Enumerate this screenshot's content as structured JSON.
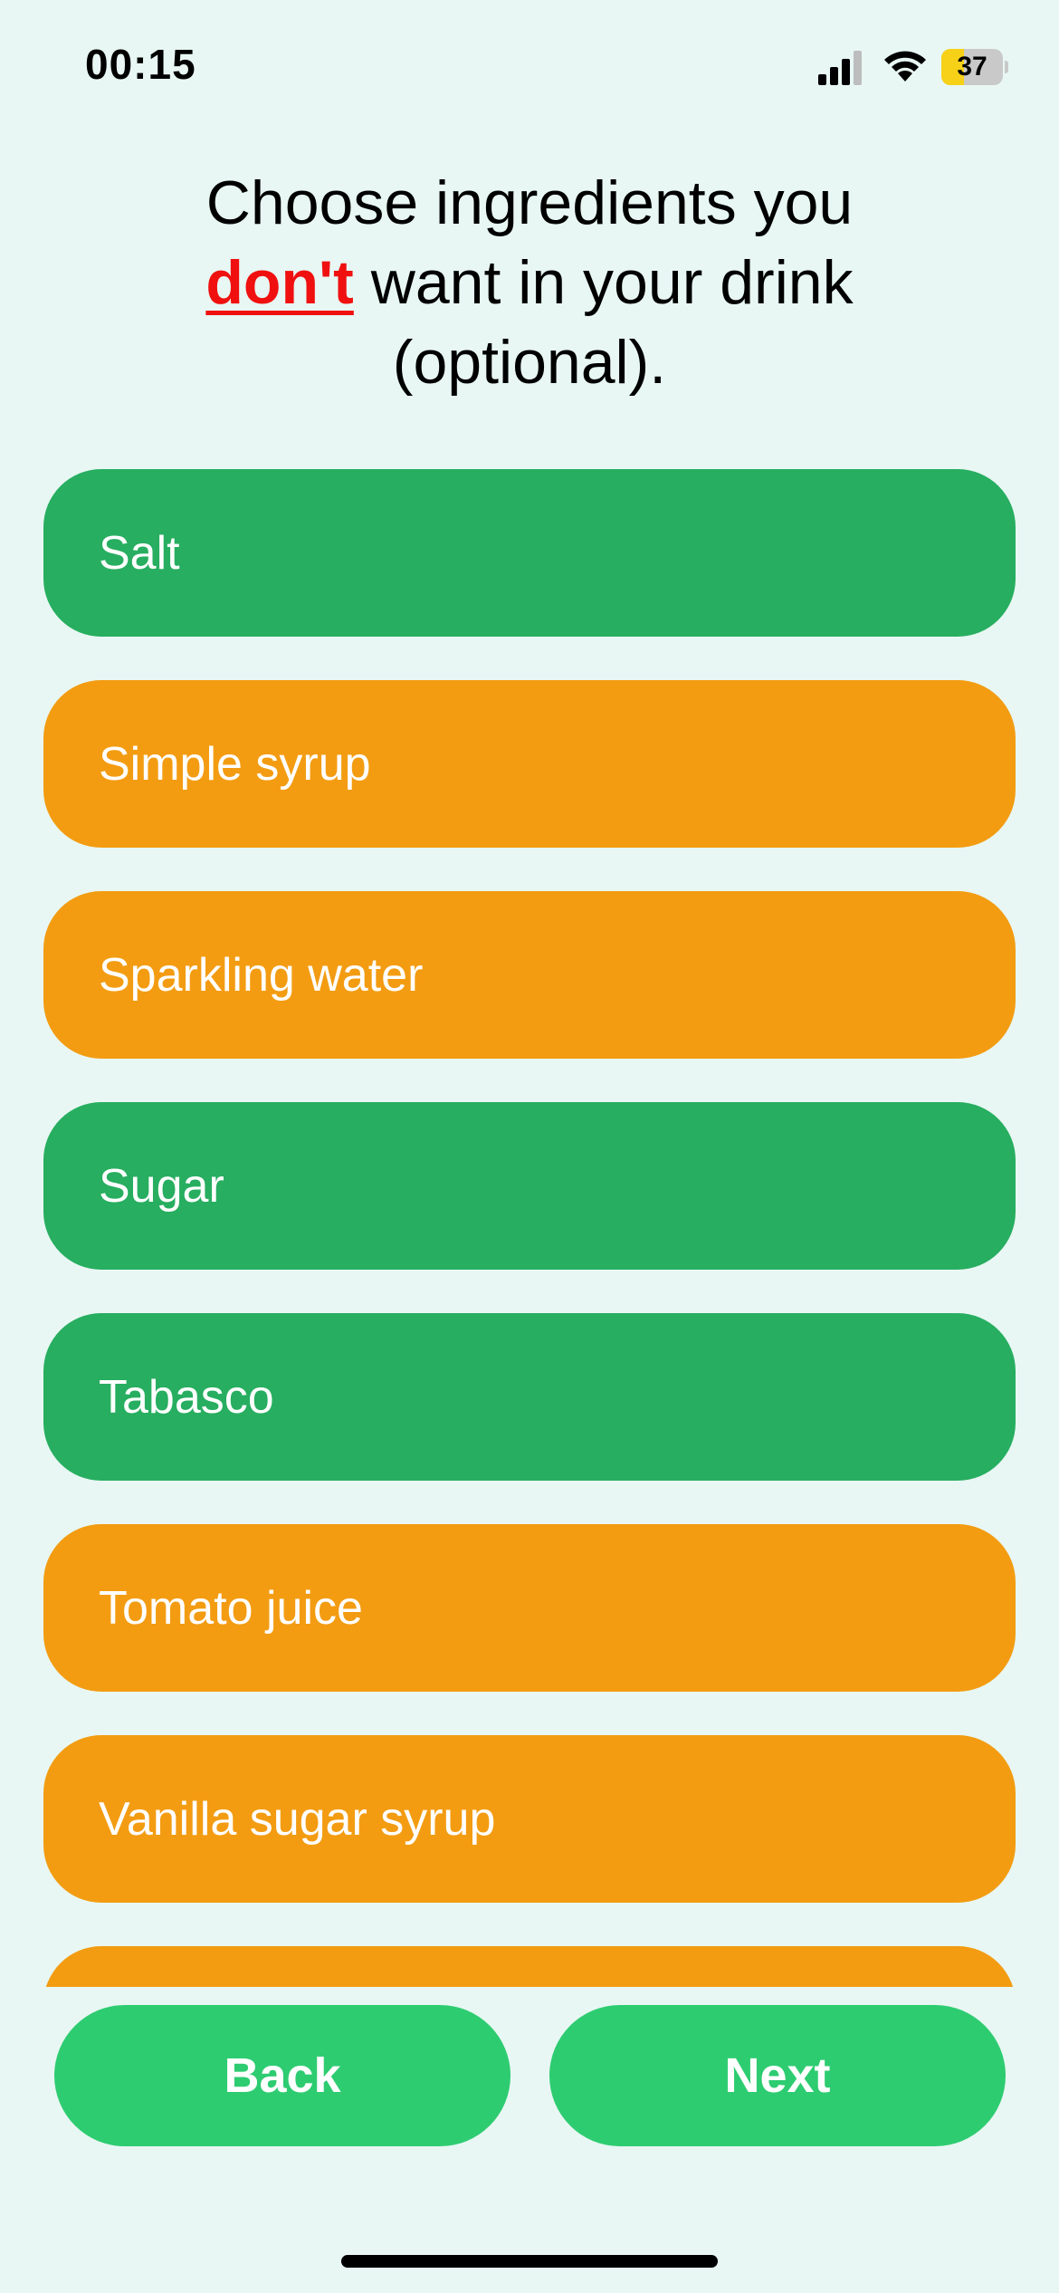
{
  "status_bar": {
    "time": "00:15",
    "battery_level": "37",
    "icons": [
      "signal-icon",
      "wifi-icon",
      "battery-icon"
    ]
  },
  "heading": {
    "line1": "Choose ingredients you",
    "negation": "don't",
    "line2_rest": " want in your drink",
    "line3": "(optional)."
  },
  "ingredients": [
    {
      "label": "Salt",
      "state": "green"
    },
    {
      "label": "Simple syrup",
      "state": "orange"
    },
    {
      "label": "Sparkling water",
      "state": "orange"
    },
    {
      "label": "Sugar",
      "state": "green"
    },
    {
      "label": "Tabasco",
      "state": "green"
    },
    {
      "label": "Tomato juice",
      "state": "orange"
    },
    {
      "label": "Vanilla sugar syrup",
      "state": "orange"
    },
    {
      "label": "",
      "state": "orange"
    }
  ],
  "buttons": {
    "back": "Back",
    "next": "Next"
  },
  "colors": {
    "background": "#E8F7F3",
    "green_option": "#27AE60",
    "orange_option": "#F39C12",
    "nav_button": "#2ECC71",
    "negation_text": "#F01010",
    "battery": "#F7D117"
  }
}
